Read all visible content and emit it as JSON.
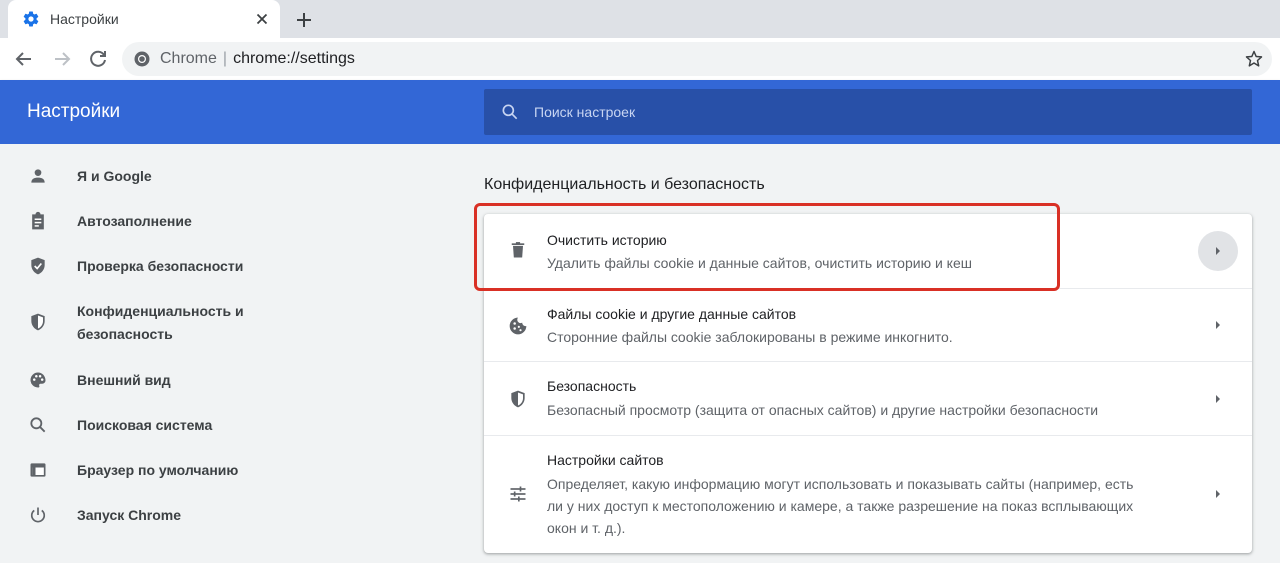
{
  "browser": {
    "tab_title": "Настройки",
    "omnibox_label": "Chrome",
    "omnibox_separator": "|",
    "omnibox_url": "chrome://settings"
  },
  "header": {
    "title": "Настройки",
    "search_placeholder": "Поиск настроек"
  },
  "sidebar": {
    "items": [
      {
        "label": "Я и Google",
        "icon": "person-icon"
      },
      {
        "label": "Автозаполнение",
        "icon": "clipboard-icon"
      },
      {
        "label": "Проверка безопасности",
        "icon": "shield-check-icon"
      },
      {
        "label": "Конфиденциальность и",
        "label2": "безопасность",
        "icon": "shield-icon"
      },
      {
        "label": "Внешний вид",
        "icon": "palette-icon"
      },
      {
        "label": "Поисковая система",
        "icon": "search-icon"
      },
      {
        "label": "Браузер по умолчанию",
        "icon": "browser-icon"
      },
      {
        "label": "Запуск Chrome",
        "icon": "power-icon"
      }
    ]
  },
  "main": {
    "section_title": "Конфиденциальность и безопасность",
    "rows": [
      {
        "title": "Очистить историю",
        "sub": "Удалить файлы cookie и данные сайтов, очистить историю и кеш",
        "icon": "trash-icon"
      },
      {
        "title": "Файлы cookie и другие данные сайтов",
        "sub": "Сторонние файлы cookie заблокированы в режиме инкогнито.",
        "icon": "cookie-icon"
      },
      {
        "title": "Безопасность",
        "sub": "Безопасный просмотр (защита от опасных сайтов) и другие настройки безопасности",
        "icon": "shield-icon"
      },
      {
        "title": "Настройки сайтов",
        "sub1": "Определяет, какую информацию могут использовать и показывать сайты (например, есть",
        "sub2": "ли у них доступ к местоположению и камере, а также разрешение на показ всплывающих",
        "sub3": "окон и т. д.).",
        "icon": "tune-icon"
      }
    ]
  },
  "colors": {
    "header": "#3367d6",
    "search": "#2850a8",
    "highlight": "#d93025"
  }
}
